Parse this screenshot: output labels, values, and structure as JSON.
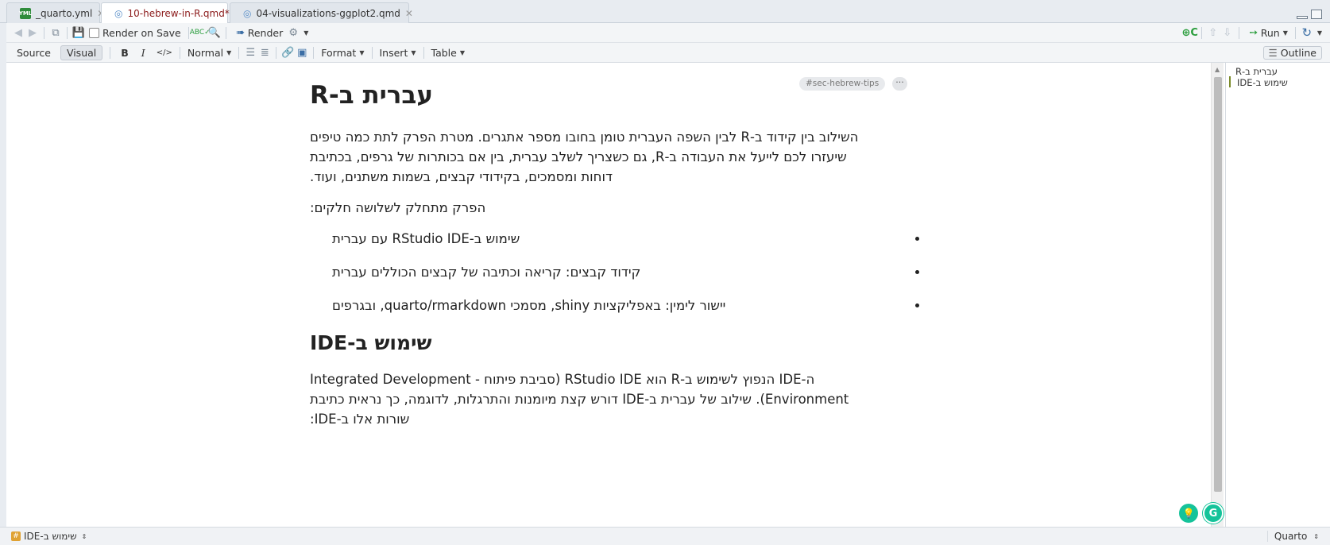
{
  "tabs": [
    {
      "label": "_quarto.yml",
      "icon": "yml-file-icon",
      "active": false
    },
    {
      "label": "10-hebrew-in-R.qmd*",
      "icon": "quarto-file-icon",
      "active": true
    },
    {
      "label": "04-visualizations-ggplot2.qmd",
      "icon": "quarto-file-icon",
      "active": false
    }
  ],
  "toolbar1": {
    "render_on_save": "Render on Save",
    "render": "Render",
    "run": "Run"
  },
  "toolbar2": {
    "source": "Source",
    "visual": "Visual",
    "bold": "B",
    "italic": "I",
    "code": "</>",
    "style": "Normal",
    "format": "Format",
    "insert": "Insert",
    "table": "Table",
    "outline": "Outline"
  },
  "doc": {
    "tag": "#sec-hebrew-tips",
    "more": "···",
    "h1": "עברית ב-R",
    "p1": "השילוב בין קידוד ב-R  לבין השפה העברית טומן בחובו מספר אתגרים. מטרת הפרק לתת כמה טיפים שיעזרו לכם לייעל את העבודה ב-R, גם כשצריך לשלב עברית, בין אם בכותרות של גרפים, בכתיבת דוחות ומסמכים, בקידודי קבצים, בשמות משתנים, ועוד.",
    "p2": "הפרק מתחלק לשלושה חלקים:",
    "bullets": [
      "שימוש ב-RStudio IDE עם עברית",
      "קידוד קבצים: קריאה וכתיבה של קבצים הכוללים עברית",
      "יישור לימין: באפליקציות shiny, מסמכי quarto/rmarkdown, ובגרפים"
    ],
    "h2": "שימוש ב-IDE",
    "p3": "ה-IDE הנפוץ לשימוש ב-R הוא RStudio IDE (סביבת פיתוח - Integrated Development Environment). שילוב של עברית ב-IDE  דורש קצת מיומנות והתרגלות, לדוגמה, כך נראית כתיבת שורות אלו ב-IDE:"
  },
  "outline": {
    "items": [
      "עברית ב-R",
      "שימוש ב-IDE"
    ]
  },
  "status": {
    "location": "שימוש ב-IDE",
    "filetype": "Quarto"
  },
  "colors": {
    "active_tab_text": "#8b1a1a",
    "outline_marker": "#7b8b2b",
    "grammarly_green": "#15c39a"
  }
}
